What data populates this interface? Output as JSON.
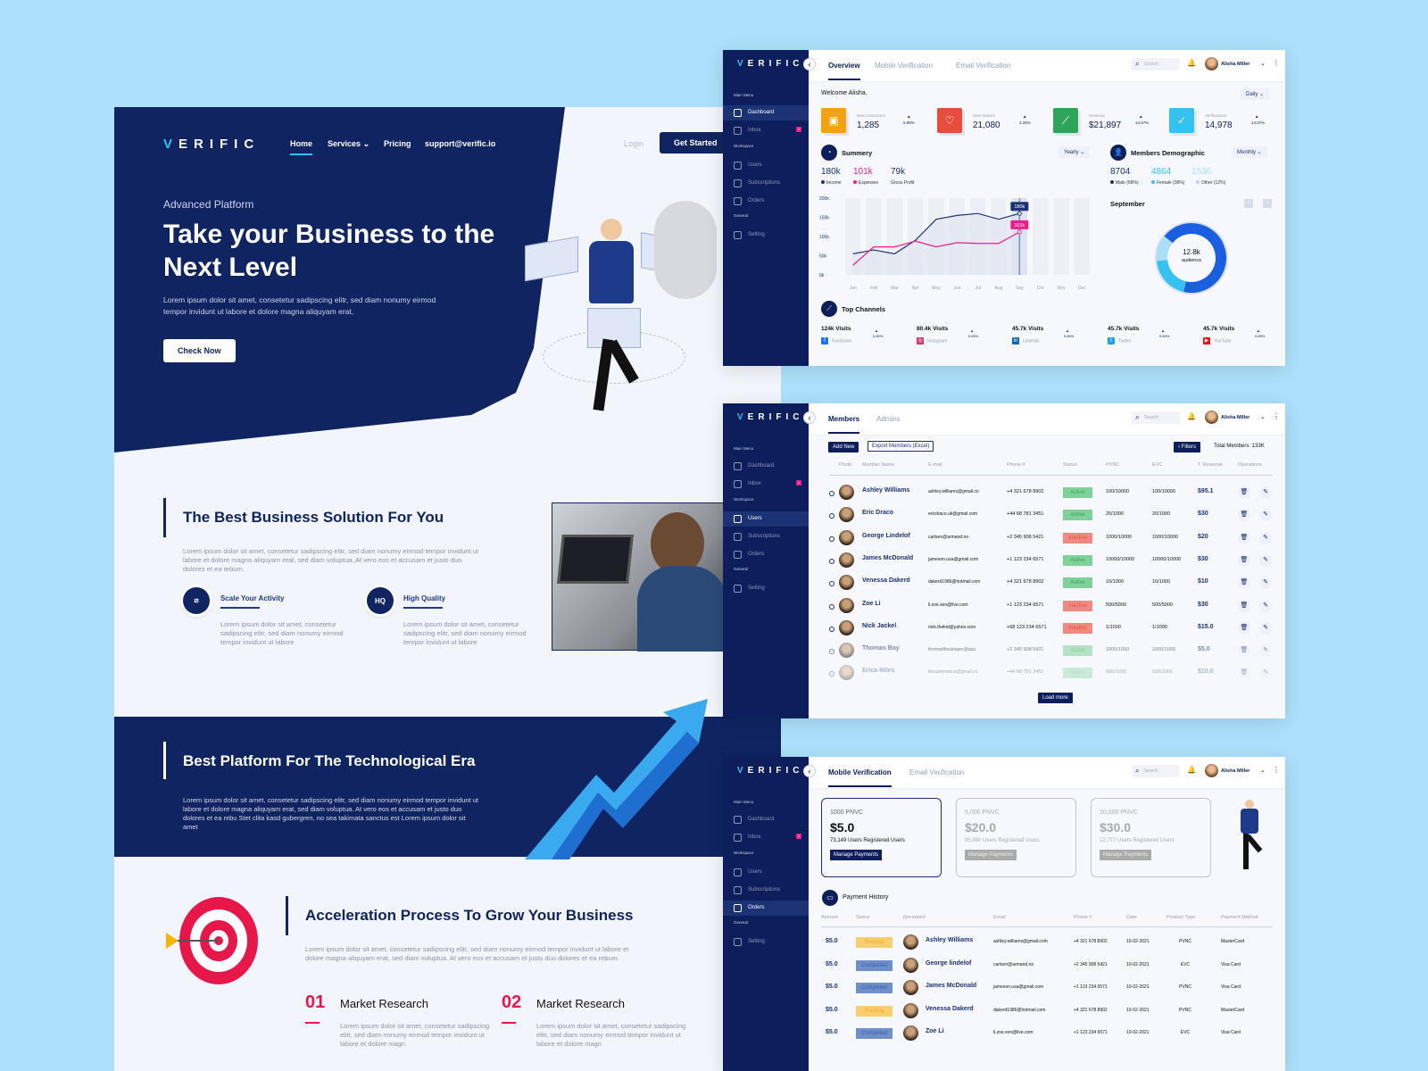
{
  "colors": {
    "background": "#ace0fb",
    "navy": "#0f2461",
    "accent": "#34c3f0",
    "income": "#1c3275",
    "expenses": "#e91e8c",
    "active": "#7fd19a",
    "inactive": "#f08a80",
    "pending": "#f9cf6e",
    "completed": "#6f8fcb",
    "red": "#e8174a"
  },
  "landing": {
    "logo": "VERIFIC",
    "nav": {
      "home": "Home",
      "services": "Services",
      "pricing": "Pricing",
      "email": "support@verific.io",
      "login": "Login",
      "get_started": "Get Started"
    },
    "hero": {
      "eyebrow": "Advanced Platform",
      "title": "Take your Business to the Next Level",
      "body": "Lorem ipsum dolor sit amet, consetetur sadipscing elitr, sed diam nonumy eirmod tempor invidunt ut labore et dolore magna aliquyam erat,",
      "cta": "Check Now"
    },
    "solution": {
      "title": "The Best Business Solution For You",
      "body": "Lorem ipsum dolor sit amet, consetetur sadipscing elitr, sed diam nonumy eirmod tempor invidunt ut labore et dolore magna aliquyam erat, sed diam voluptua. At vero eos et accusam et justo duo dolores et ea rebum.",
      "features": [
        {
          "icon": "scale-icon",
          "title": "Scale Your Activity",
          "body": "Lorem ipsum dolor sit amet, consetetur sadipscing elitr, sed diam nonumy eirmod tempor invidunt ut labore"
        },
        {
          "icon": "hq-icon",
          "icon_text": "HQ",
          "title": "High Quality",
          "body": "Lorem ipsum dolor sit amet, consetetur sadipscing elitr, sed diam nonumy eirmod tempor invidunt ut labore"
        }
      ]
    },
    "platform": {
      "title": "Best Platform For The  Technological Era",
      "body": "Lorem ipsum dolor sit amet, consetetur sadipscing elitr, sed diam nonumy eirmod tempor invidunt ut labore et dolore magna aliquyam erat, sed diam voluptua. At vero eos et accusam et justo duo dolores et ea rebu Stet clita kasd gubergren, no sea takimata sanctus est Lorem ipsum dolor sit amet"
    },
    "acceleration": {
      "title": "Acceleration Process To Grow Your Business",
      "body": "Lorem ipsum dolor sit amet, consetetur sadipscing elitr, sed diam nonumy eirmod tempor invidunt ut labore et dolore magna aliquyam erat, sed diam voluptua. At vero eos et accusam et justo duo dolores et ea rebum.",
      "steps": [
        {
          "num": "01",
          "title": "Market Research",
          "body": "Lorem ipsum dolor sit amet, consetetur sadipscing elitr, sed diam nonumy eirmod tempor invidunt ut labore et dolore magn"
        },
        {
          "num": "02",
          "title": "Market Research",
          "body": "Lorem ipsum dolor sit amet, consetetur sadipscing elitr, sed diam nonumy eirmod tempor invidunt ut labore et dolore magn"
        }
      ]
    }
  },
  "app": {
    "logo": "VERIFIC",
    "user": "Alisha Miller",
    "search_placeholder": "Search",
    "sidebar": {
      "main_menu": "Main Menu",
      "dashboard": "Dashboard",
      "inbox": "Inbox",
      "inbox_badge": "1",
      "workspace": "Workspace",
      "users": "Users",
      "subscriptions": "Subscriptions",
      "orders": "Orders",
      "general": "General",
      "setting": "Setting"
    }
  },
  "dashboard": {
    "tabs": [
      "Overview",
      "Mobile Verification",
      "Email Verification"
    ],
    "welcome": "Welcome Alisha.",
    "period": "Daily",
    "stats": [
      {
        "label": "New Customers",
        "value": "1,285",
        "pct": "5.89%",
        "color": "#f5a011",
        "icon": "customers-icon"
      },
      {
        "label": "New Visitors",
        "value": "21,080",
        "pct": "4.28%",
        "color": "#e84c3d",
        "icon": "heart-icon"
      },
      {
        "label": "Revenue",
        "value": "$21,897",
        "pct": "14.07%",
        "color": "#2ea55a",
        "icon": "chart-icon"
      },
      {
        "label": "Verifications",
        "value": "14,978",
        "pct": "14.07%",
        "color": "#34c3f0",
        "icon": "check-icon"
      }
    ],
    "summary": {
      "title": "Summery",
      "period": "Yearly",
      "income": "180k",
      "income_label": "Income",
      "expenses": "101k",
      "expenses_label": "Expenses",
      "profit": "79k",
      "profit_label": "Gross Profit"
    },
    "demographic": {
      "title": "Members Demographic",
      "period": "Monthly",
      "male": "8704",
      "male_label": "Male (68%)",
      "female": "4864",
      "female_label": "Female (38%)",
      "other": "1536",
      "other_label": "Other (12%)",
      "month": "September",
      "center_value": "12.8k",
      "center_label": "audience"
    },
    "channels": {
      "title": "Top Channels",
      "items": [
        {
          "visits": "124k Visits",
          "name": "Facebook",
          "pct": "5.89%",
          "icon": "facebook-icon",
          "color": "#1877f2",
          "glyph": "f"
        },
        {
          "visits": "80.4k Visits",
          "name": "Instagram",
          "pct": "5.89%",
          "icon": "instagram-icon",
          "color": "#d6336c",
          "glyph": "◎"
        },
        {
          "visits": "45.7k Visits",
          "name": "Linkedin",
          "pct": "5.89%",
          "icon": "linkedin-icon",
          "color": "#0a66c2",
          "glyph": "in"
        },
        {
          "visits": "45.7k Visits",
          "name": "Twitter",
          "pct": "5.89%",
          "icon": "twitter-icon",
          "color": "#1da1f2",
          "glyph": "t"
        },
        {
          "visits": "45.7k Visits",
          "name": "YouTube",
          "pct": "5.89%",
          "icon": "youtube-icon",
          "color": "#ff0000",
          "glyph": "▶"
        }
      ]
    }
  },
  "chart_data": {
    "type": "line",
    "categories": [
      "Jan",
      "Feb",
      "Mar",
      "Apr",
      "May",
      "Jun",
      "Jul",
      "Aug",
      "Sep",
      "Oct",
      "Nov",
      "Dec"
    ],
    "yticks": [
      "200k",
      "150k",
      "100k",
      "50k",
      "0k"
    ],
    "ylim": [
      0,
      200
    ],
    "series": [
      {
        "name": "Income",
        "values": [
          55,
          65,
          55,
          90,
          145,
          155,
          160,
          145,
          160,
          null,
          null,
          null
        ]
      },
      {
        "name": "Expenses",
        "values": [
          25,
          73,
          73,
          88,
          73,
          84,
          82,
          82,
          112,
          null,
          null,
          null
        ]
      }
    ],
    "highlight": {
      "category": "Sep",
      "labels": [
        "180k",
        "101k"
      ]
    },
    "donut": {
      "values": [
        68,
        20,
        12
      ],
      "colors": [
        "#1a5fe0",
        "#34c3f0",
        "#a8e0fb"
      ]
    }
  },
  "members": {
    "tabs": [
      "Members",
      "Admins"
    ],
    "add_new": "Add New",
    "export": "Export Members (Excel)",
    "filters": "Filters",
    "total": "Total Members: 133K",
    "load_more": "Load more",
    "columns": [
      "Photo",
      "Member Name",
      "E-mail",
      "Phone #",
      "Status",
      "PVNC",
      "EVC",
      "T. Revenue",
      "Operations"
    ],
    "rows": [
      [
        "Ashley Williams",
        "ashley.williams@gmail.co",
        "+4 321 678 8902",
        "Active",
        "100/10000",
        "100/10000",
        "$95.1"
      ],
      [
        "Eric Draco",
        "ericdraco.uk@gmail.com",
        "+44 68 781 3451",
        "Active",
        "20/1000",
        "20/1000",
        "$30"
      ],
      [
        "George Lindelof",
        "carlsen@armand.no",
        "+2 345 908 5421",
        "Inactive",
        "1000/10000",
        "1000/10000",
        "$20"
      ],
      [
        "James McDonald",
        "jameson.usa@gmail.com",
        "+1 123 234 6571",
        "Active",
        "10000/10000",
        "10000/10000",
        "$30"
      ],
      [
        "Venessa Dakerd",
        "dakerd1986@hotmail.com",
        "+4 321 678 8902",
        "Active",
        "10/1000",
        "10/1000",
        "$10"
      ],
      [
        "Zoe Li",
        "li.zoe.xen@live.com",
        "+1 123 234 6571",
        "Inactive",
        "500/5000",
        "500/5000",
        "$30"
      ],
      [
        "Nick Jackel",
        "nick.thekid@yahoo.com",
        "+68 123 234 6571",
        "Inactive",
        "1/1000",
        "1/1000",
        "$15.0"
      ],
      [
        "Thomas Bay",
        "thomasthesleeper@spa",
        "+2 345 908 5421",
        "Active",
        "1000/1000",
        "1000/1000",
        "$5.0"
      ],
      [
        "Erica Miles",
        "thequeenerica@gmail.co",
        "+44 68 781 3451",
        "Active",
        "500/1000",
        "500/1000",
        "$10.0"
      ]
    ]
  },
  "payments": {
    "tabs": [
      "Mobile Verification",
      "Email Verification"
    ],
    "plans": [
      {
        "title": "1000 PNVC",
        "price": "$5.0",
        "users": "73,149 Users Registered Users",
        "button": "Manage Payments"
      },
      {
        "title": "5,000 PNVC",
        "price": "$20.0",
        "users": "35,890 Users Registered Users",
        "button": "Manage Payments"
      },
      {
        "title": "10,000 PNVC",
        "price": "$30.0",
        "users": "12,777 Users Registered Users",
        "button": "Manage Payments"
      }
    ],
    "history_title": "Payment History",
    "columns": [
      "Amount",
      "Status",
      "Recepient",
      "Email",
      "Phone #",
      "Date",
      "Product Type",
      "Payment Method"
    ],
    "rows": [
      [
        "$5.0",
        "Pending",
        "Ashley Williams",
        "ashley.williams@gmail.com",
        "+4 321 678 8902",
        "10-02-2021",
        "PVNC",
        "MasterCard"
      ],
      [
        "$5.0",
        "Completed",
        "George lindelof",
        "carlsen@armand.no",
        "+2 345 908 5421",
        "10-02-2021",
        "EVC",
        "Visa Card"
      ],
      [
        "$5.0",
        "Completed",
        "James McDonald",
        "jameson.usa@gmail.com",
        "+1 123 234 6571",
        "10-02-2021",
        "PVNC",
        "Visa Card"
      ],
      [
        "$5.0",
        "Pending",
        "Venessa Dakerd",
        "dakerd1986@hotmail.com",
        "+4 321 678 8902",
        "10-02-2021",
        "PVNC",
        "MasterCard"
      ],
      [
        "$5.0",
        "Completed",
        "Zoe Li",
        "li.zoe.xen@live.com",
        "+1 123 234 6571",
        "10-02-2021",
        "EVC",
        "Visa Card"
      ]
    ]
  }
}
